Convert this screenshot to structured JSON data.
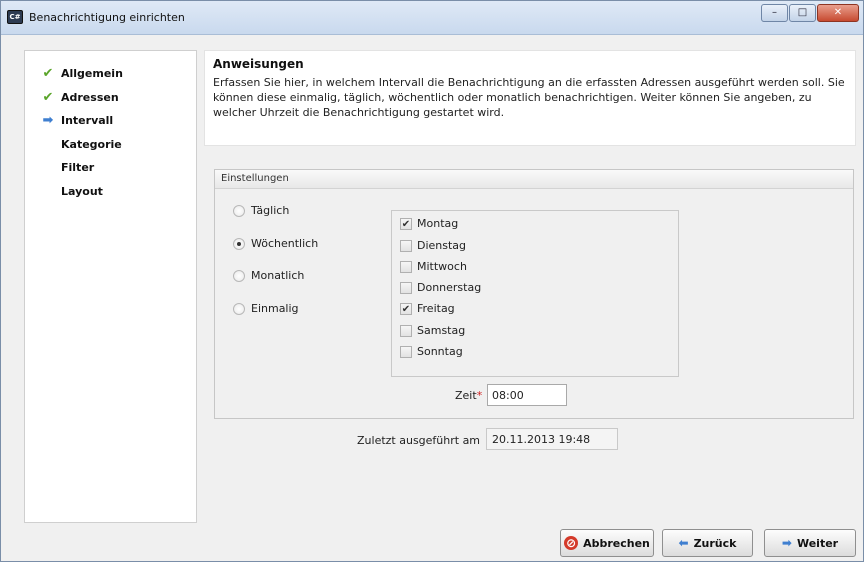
{
  "window": {
    "title": "Benachrichtigung einrichten",
    "icon": "app-icon",
    "app_icon_text": "C#",
    "controls": {
      "minimize": "–",
      "maximize": "□",
      "close": "✕"
    }
  },
  "nav": {
    "items": [
      {
        "label": "Allgemein",
        "state": "done",
        "icon": "check-icon"
      },
      {
        "label": "Adressen",
        "state": "done",
        "icon": "check-icon"
      },
      {
        "label": "Intervall",
        "state": "current",
        "icon": "arrow-right-icon"
      },
      {
        "label": "Kategorie",
        "state": "pending",
        "icon": ""
      },
      {
        "label": "Filter",
        "state": "pending",
        "icon": ""
      },
      {
        "label": "Layout",
        "state": "pending",
        "icon": ""
      }
    ]
  },
  "instructions": {
    "title": "Anweisungen",
    "text": "Erfassen Sie hier, in welchem Intervall die Benachrichtigung an die erfassten Adressen ausgeführt werden soll. Sie können diese einmalig, täglich, wöchentlich oder monatlich benachrichtigen. Weiter können Sie angeben, zu welcher Uhrzeit die Benachrichtigung gestartet wird."
  },
  "settings": {
    "title": "Einstellungen",
    "interval_options": [
      {
        "label": "Täglich",
        "selected": false
      },
      {
        "label": "Wöchentlich",
        "selected": true
      },
      {
        "label": "Monatlich",
        "selected": false
      },
      {
        "label": "Einmalig",
        "selected": false
      }
    ],
    "days": [
      {
        "label": "Montag",
        "checked": true
      },
      {
        "label": "Dienstag",
        "checked": false
      },
      {
        "label": "Mittwoch",
        "checked": false
      },
      {
        "label": "Donnerstag",
        "checked": false
      },
      {
        "label": "Freitag",
        "checked": true
      },
      {
        "label": "Samstag",
        "checked": false
      },
      {
        "label": "Sonntag",
        "checked": false
      }
    ],
    "time_label": "Zeit",
    "required_marker": "*",
    "time_value": "08:00"
  },
  "last_run": {
    "label": "Zuletzt ausgeführt am",
    "value": "20.11.2013 19:48"
  },
  "buttons": {
    "cancel": "Abbrechen",
    "back": "Zurück",
    "next": "Weiter"
  }
}
